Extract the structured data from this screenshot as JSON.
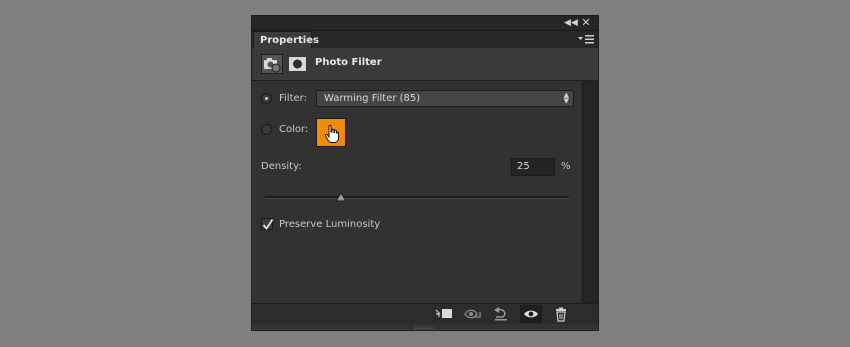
{
  "panel": {
    "tab_label": "Properties",
    "title": "Photo Filter",
    "topbar_icons": [
      "collapse-icon",
      "close-icon"
    ],
    "panel_menu_icon": "panel-menu-icon"
  },
  "filter": {
    "label": "Filter:",
    "selected": "Warming Filter (85)",
    "radio_selected": true
  },
  "color": {
    "label": "Color:",
    "swatch_hex": "#f38a0a",
    "radio_selected": false
  },
  "density": {
    "label": "Density:",
    "value": "25",
    "unit": "%",
    "slider_percent": 25
  },
  "preserve_luminosity": {
    "label": "Preserve Luminosity",
    "checked": true
  },
  "footer_icons": [
    "clip-to-layer-icon",
    "view-previous-state-icon",
    "reset-icon",
    "visibility-eye-icon",
    "trash-icon"
  ],
  "colors": {
    "background": "#808080",
    "panel": "#323232",
    "accent_orange": "#f38a0a"
  }
}
